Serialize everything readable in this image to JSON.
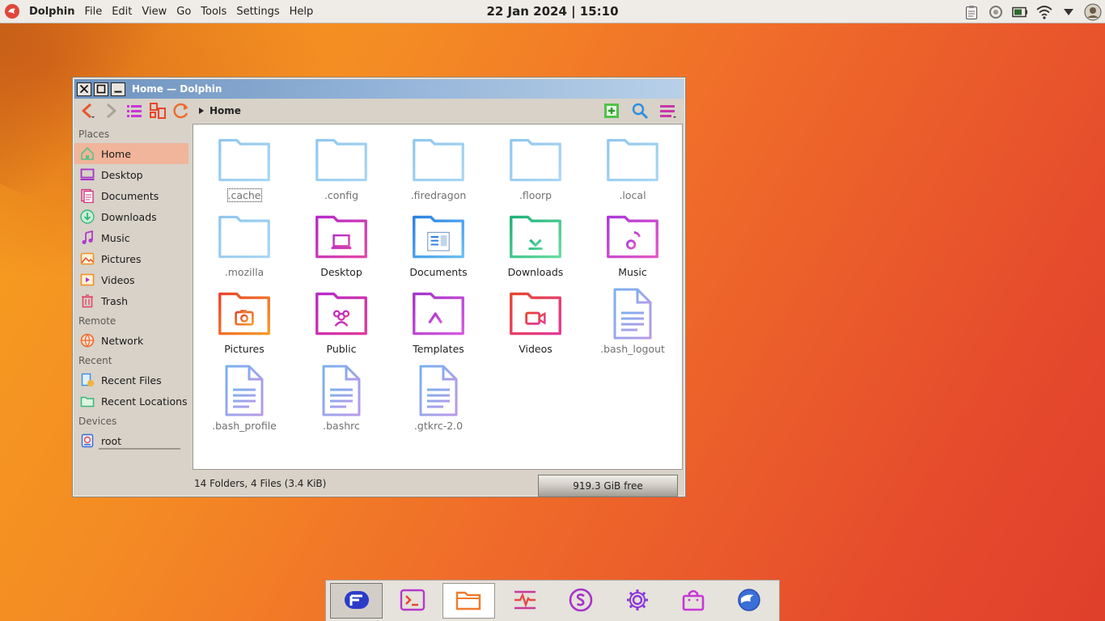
{
  "panel": {
    "app_name": "Dolphin",
    "menu": [
      "File",
      "Edit",
      "View",
      "Go",
      "Tools",
      "Settings",
      "Help"
    ],
    "clock": "22 Jan 2024 | 15:10"
  },
  "window": {
    "title": "Home — Dolphin",
    "breadcrumb": "Home",
    "status": "14 Folders, 4 Files (3.4 KiB)",
    "free_space": "919.3 GiB free"
  },
  "sidebar": {
    "places_label": "Places",
    "places": [
      "Home",
      "Desktop",
      "Documents",
      "Downloads",
      "Music",
      "Pictures",
      "Videos",
      "Trash"
    ],
    "remote_label": "Remote",
    "remote": [
      "Network"
    ],
    "recent_label": "Recent",
    "recent": [
      "Recent Files",
      "Recent Locations"
    ],
    "devices_label": "Devices",
    "devices": [
      "root"
    ],
    "root_usage_fraction": 0.95
  },
  "files": [
    {
      "name": ".cache",
      "kind": "folder-plain"
    },
    {
      "name": ".config",
      "kind": "folder-plain"
    },
    {
      "name": ".firedragon",
      "kind": "folder-plain"
    },
    {
      "name": ".floorp",
      "kind": "folder-plain"
    },
    {
      "name": ".local",
      "kind": "folder-plain"
    },
    {
      "name": ".mozilla",
      "kind": "folder-plain"
    },
    {
      "name": "Desktop",
      "kind": "folder-desktop"
    },
    {
      "name": "Documents",
      "kind": "folder-documents"
    },
    {
      "name": "Downloads",
      "kind": "folder-downloads"
    },
    {
      "name": "Music",
      "kind": "folder-music"
    },
    {
      "name": "Pictures",
      "kind": "folder-pictures"
    },
    {
      "name": "Public",
      "kind": "folder-public"
    },
    {
      "name": "Templates",
      "kind": "folder-templates"
    },
    {
      "name": "Videos",
      "kind": "folder-videos"
    },
    {
      "name": ".bash_logout",
      "kind": "text-file"
    },
    {
      "name": ".bash_profile",
      "kind": "text-file"
    },
    {
      "name": ".bashrc",
      "kind": "text-file"
    },
    {
      "name": ".gtkrc-2.0",
      "kind": "text-file"
    }
  ],
  "colors": {
    "accent": "#f0b59a",
    "plain_folder": "#8ec8ef",
    "titlebar_start": "#6e92be"
  },
  "dock": [
    "garuda-icon",
    "terminal-icon",
    "file-manager-icon",
    "system-monitor-icon",
    "store-icon",
    "settings-icon",
    "shopping-bag-icon",
    "browser-icon"
  ]
}
